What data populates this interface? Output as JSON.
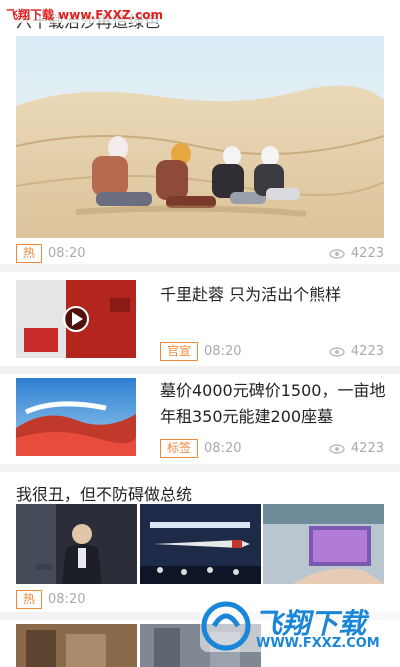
{
  "watermark_top": "飞翔下载 www.FXXZ.com",
  "top_title": "六十载治沙再造绿色",
  "articles": [
    {
      "tag": "热",
      "time": "08:20",
      "views": "4223"
    },
    {
      "title": "千里赴蓉 只为活出个熊样",
      "tag": "官宣",
      "time": "08:20",
      "views": "4223"
    },
    {
      "title": "墓价4000元碑价1500，一亩地年租350元能建200座墓",
      "tag": "标签",
      "time": "08:20",
      "views": "4223"
    },
    {
      "title": "我很丑，但不防碍做总统",
      "tag": "热",
      "time": "08:20"
    }
  ],
  "watermark_bottom": {
    "brand": "飞翔下载",
    "url": "WWW.FXXZ.COM"
  },
  "colors": {
    "tag": "#f08a3a",
    "meta": "#aaaaaa",
    "divider": "#f2f2f2",
    "watermark_blue": "#1a86d8"
  },
  "icons": {
    "views": "eye-icon",
    "play": "play-icon"
  }
}
